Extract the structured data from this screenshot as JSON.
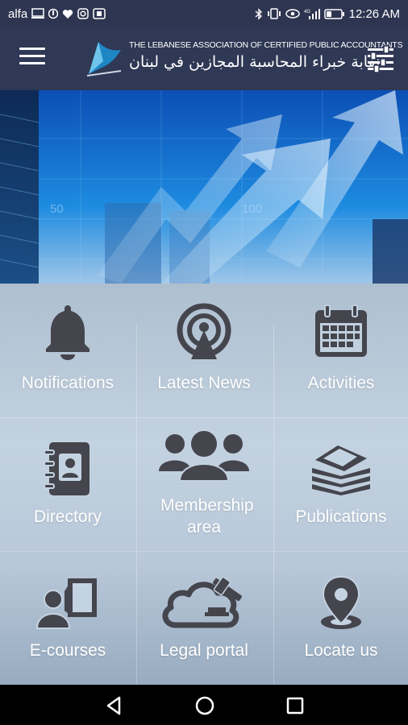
{
  "status_bar": {
    "carrier": "alfa",
    "time": "12:26 AM",
    "left_icons": [
      "screen-icon",
      "vpn-icon",
      "heart-icon",
      "instagram-icon",
      "tablet-icon"
    ],
    "right_icons": [
      "bluetooth-icon",
      "vibrate-icon",
      "eye-icon",
      "signal-icon",
      "battery-icon"
    ]
  },
  "header": {
    "logo_en": "THE LEBANESE ASSOCIATION OF CERTIFIED PUBLIC ACCOUNTANTS",
    "logo_ar": "نقابة خبراء المحاسبة المجازين في لبنان",
    "menu_icon": "hamburger-icon",
    "filter_icon": "sliders-icon",
    "color": "#2f3854"
  },
  "banner": {
    "numbers": [
      "50",
      "100"
    ]
  },
  "tiles": [
    {
      "label": "Notifications",
      "icon": "bell-icon"
    },
    {
      "label": "Latest News",
      "icon": "broadcast-icon"
    },
    {
      "label": "Activities",
      "icon": "calendar-icon"
    },
    {
      "label": "Directory",
      "icon": "contacts-book-icon"
    },
    {
      "label": "Membership area",
      "icon": "group-icon"
    },
    {
      "label": "Publications",
      "icon": "books-icon"
    },
    {
      "label": "E-courses",
      "icon": "video-lesson-icon"
    },
    {
      "label": "Legal portal",
      "icon": "cloud-gavel-icon"
    },
    {
      "label": "Locate us",
      "icon": "location-pin-icon"
    }
  ],
  "colors": {
    "icon": "#45454d",
    "label": "#ffffff",
    "app_bar": "#2f3854"
  }
}
